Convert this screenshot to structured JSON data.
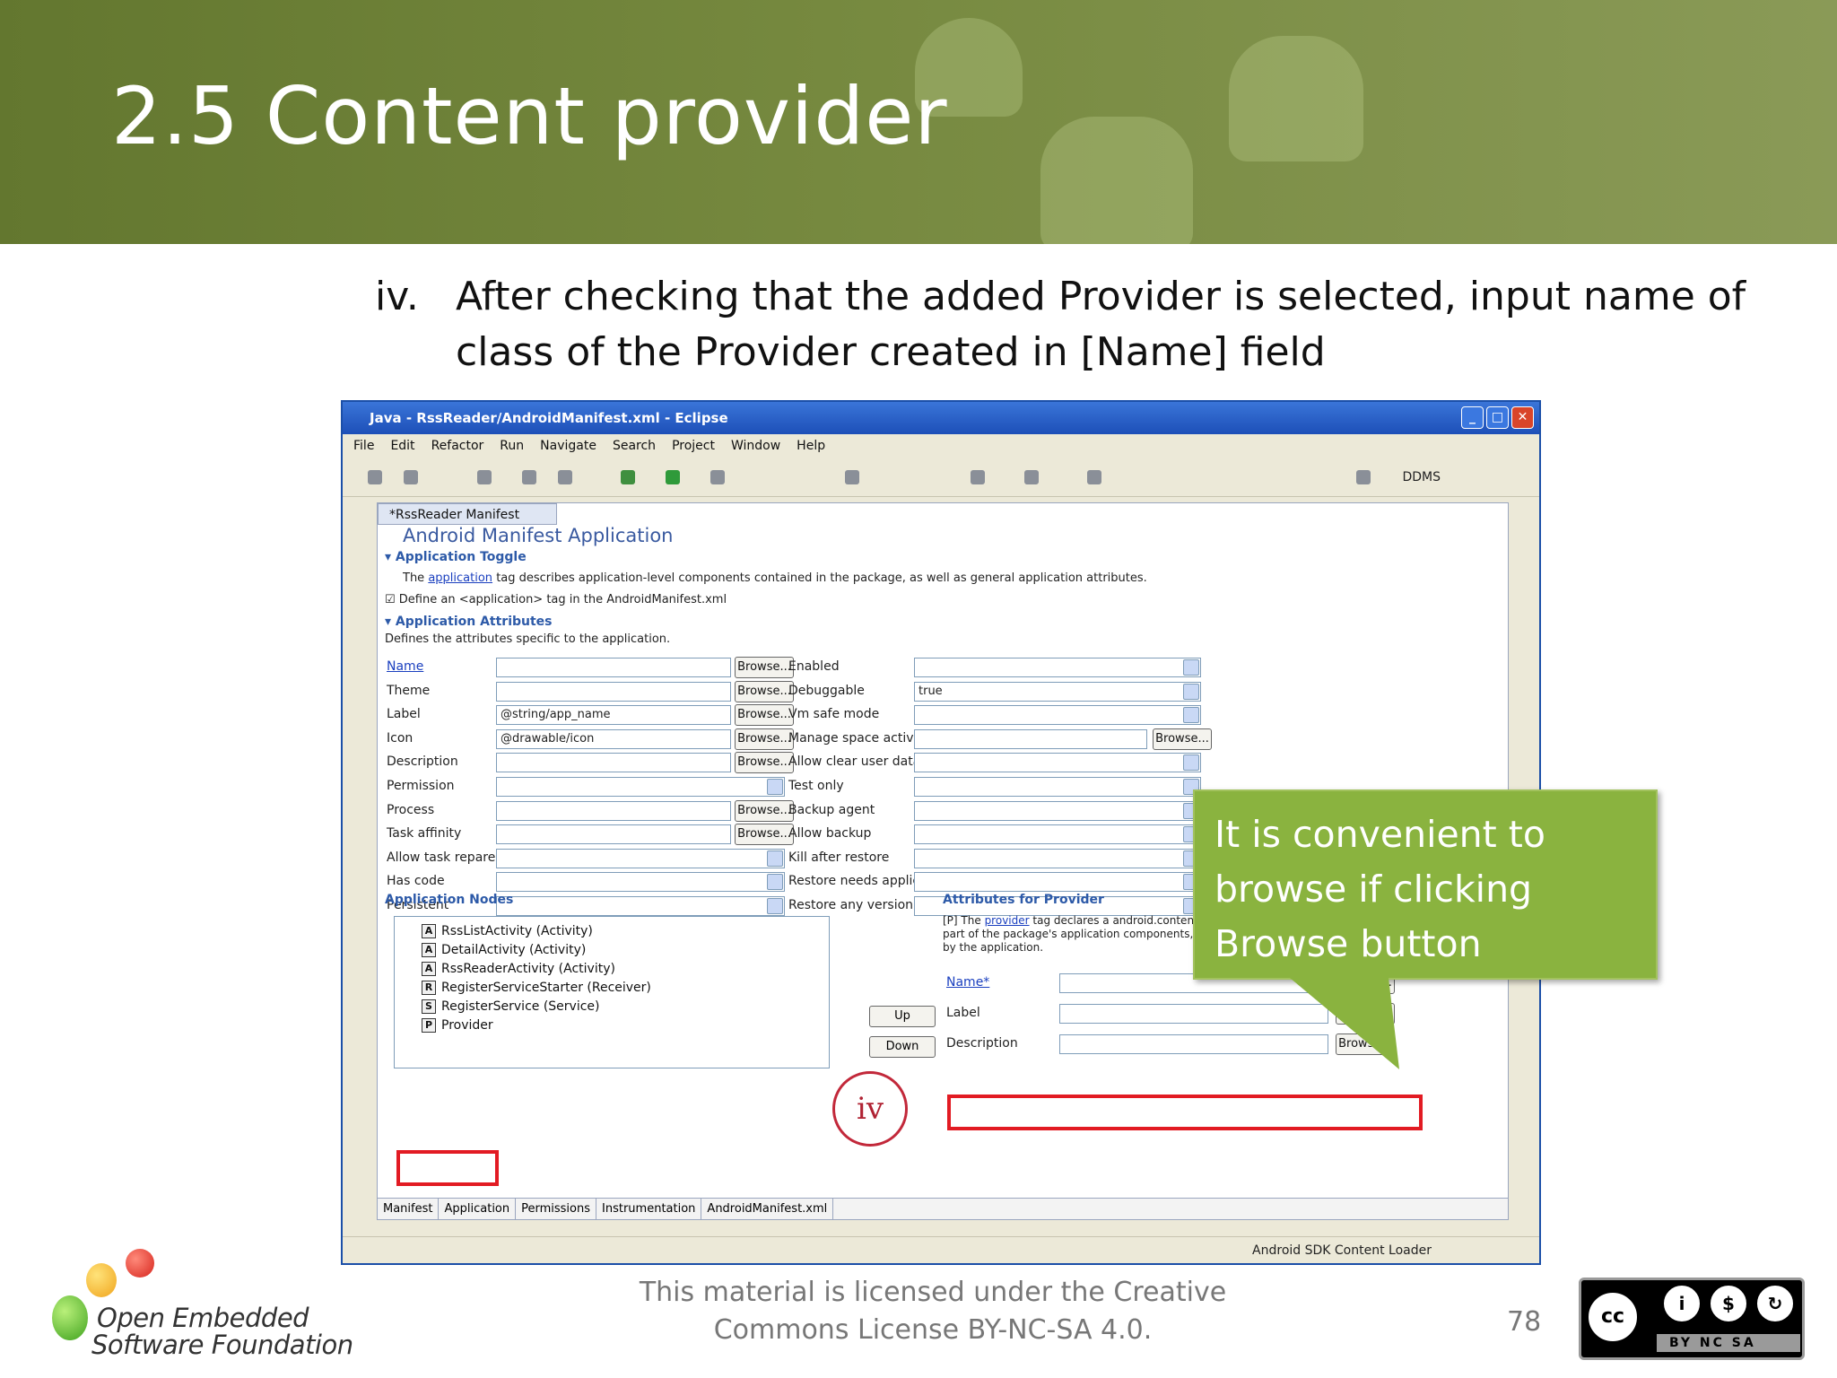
{
  "slide": {
    "title": "2.5 Content provider",
    "step_number": "iv.",
    "step_text": "After checking that the added Provider is selected, input name of class of the Provider created in [Name] field"
  },
  "window": {
    "title": "Java - RssReader/AndroidManifest.xml - Eclipse",
    "menu": [
      "File",
      "Edit",
      "Refactor",
      "Run",
      "Navigate",
      "Search",
      "Project",
      "Window",
      "Help"
    ],
    "perspective": "DDMS",
    "editor_tab": "*RssReader Manifest",
    "editor_heading": "Android Manifest Application",
    "status_text": "Android SDK Content Loader"
  },
  "application_toggle": {
    "header": "Application Toggle",
    "description_prefix": "The",
    "description_link": "application",
    "description_rest": "tag describes application-level components contained in the package, as well as general application attributes.",
    "checkbox_label": "Define an <application> tag in the AndroidManifest.xml"
  },
  "application_attributes": {
    "header": "Application Attributes",
    "description": "Defines the attributes specific to the application.",
    "browse_label": "Browse...",
    "left_fields": [
      {
        "label": "Name",
        "value": ""
      },
      {
        "label": "Theme",
        "value": ""
      },
      {
        "label": "Label",
        "value": "@string/app_name"
      },
      {
        "label": "Icon",
        "value": "@drawable/icon"
      },
      {
        "label": "Description",
        "value": ""
      },
      {
        "label": "Permission",
        "value": ""
      },
      {
        "label": "Process",
        "value": ""
      },
      {
        "label": "Task affinity",
        "value": ""
      },
      {
        "label": "Allow task reparenting",
        "value": ""
      },
      {
        "label": "Has code",
        "value": ""
      },
      {
        "label": "Persistent",
        "value": ""
      }
    ],
    "right_fields": [
      {
        "label": "Enabled",
        "value": ""
      },
      {
        "label": "Debuggable",
        "value": "true"
      },
      {
        "label": "Vm safe mode",
        "value": ""
      },
      {
        "label": "Manage space activity",
        "value": ""
      },
      {
        "label": "Allow clear user data",
        "value": ""
      },
      {
        "label": "Test only",
        "value": ""
      },
      {
        "label": "Backup agent",
        "value": ""
      },
      {
        "label": "Allow backup",
        "value": ""
      },
      {
        "label": "Kill after restore",
        "value": ""
      },
      {
        "label": "Restore needs application",
        "value": ""
      },
      {
        "label": "Restore any version",
        "value": ""
      }
    ]
  },
  "application_nodes": {
    "header": "Application Nodes",
    "items": [
      {
        "icon": "A",
        "label": "RssListActivity (Activity)"
      },
      {
        "icon": "A",
        "label": "DetailActivity (Activity)"
      },
      {
        "icon": "A",
        "label": "RssReaderActivity (Activity)"
      },
      {
        "icon": "R",
        "label": "RegisterServiceStarter (Receiver)"
      },
      {
        "icon": "S",
        "label": "RegisterService (Service)"
      },
      {
        "icon": "P",
        "label": "Provider"
      }
    ],
    "up_label": "Up",
    "down_label": "Down"
  },
  "provider_attributes": {
    "header": "Attributes for Provider",
    "desc_prefix": "[P] The",
    "desc_link": "provider",
    "desc_text": "tag declares a android.content.ContentProvider class that is available as part of the package's application components, supplying structured access to data managed by the application.",
    "fields": [
      {
        "label": "Name*",
        "value": ""
      },
      {
        "label": "Label",
        "value": ""
      },
      {
        "label": "Description",
        "value": ""
      }
    ]
  },
  "editor_bottom_tabs": [
    "Manifest",
    "Application",
    "Permissions",
    "Instrumentation",
    "AndroidManifest.xml"
  ],
  "annotations": {
    "marker": "iv",
    "callout": "It is convenient to browse if clicking Browse button"
  },
  "footer": {
    "logo_line1": "Open Embedded",
    "logo_line2": "Software Foundation",
    "license": "This material is licensed under the Creative Commons License BY-NC-SA 4.0.",
    "page_number": "78",
    "cc_text": "BY  NC  SA"
  },
  "colors": {
    "header_green": "#6b7e36",
    "callout_green": "#8ab33f",
    "highlight_red": "#e21b23",
    "xp_blue": "#2457c5"
  }
}
